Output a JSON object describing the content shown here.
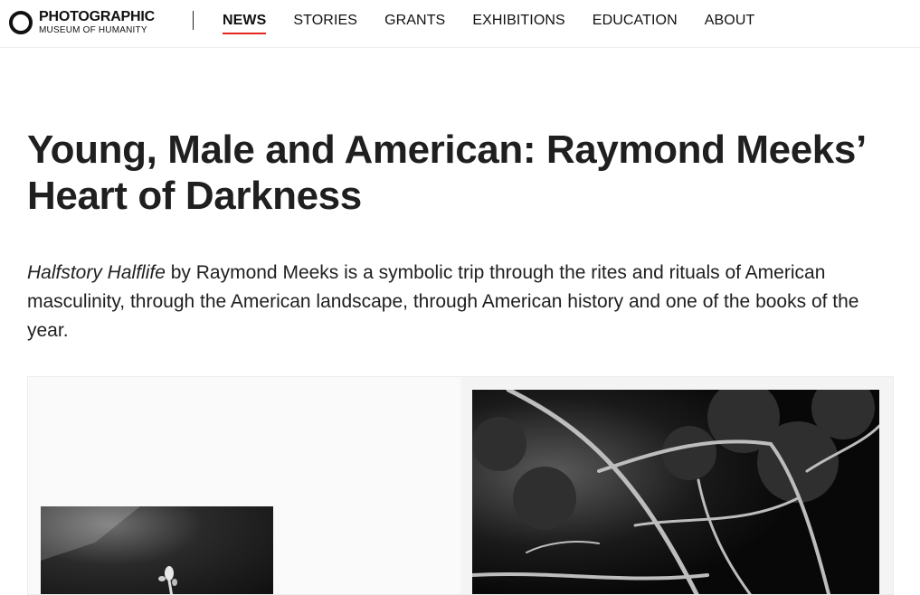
{
  "header": {
    "logo": {
      "line1": "PHOTOGRAPHIC",
      "line2": "MUSEUM OF HUMANITY",
      "icon": "ring-icon"
    },
    "nav": [
      {
        "label": "NEWS",
        "active": true
      },
      {
        "label": "STORIES",
        "active": false
      },
      {
        "label": "GRANTS",
        "active": false
      },
      {
        "label": "EXHIBITIONS",
        "active": false
      },
      {
        "label": "EDUCATION",
        "active": false
      },
      {
        "label": "ABOUT",
        "active": false
      }
    ],
    "active_underline_color": "#e5281f"
  },
  "article": {
    "title": "Young, Male and American: Raymond Meeks’ Heart of Darkness",
    "intro_italic": "Halfstory Halflife",
    "intro_rest": " by Raymond Meeks is a symbolic trip through the rites and rituals of American masculinity, through the American landscape, through American history and one of the books of the year."
  },
  "gallery": {
    "left_image": "black-and-white-photo-flower",
    "right_image": "black-and-white-photo-branches"
  }
}
